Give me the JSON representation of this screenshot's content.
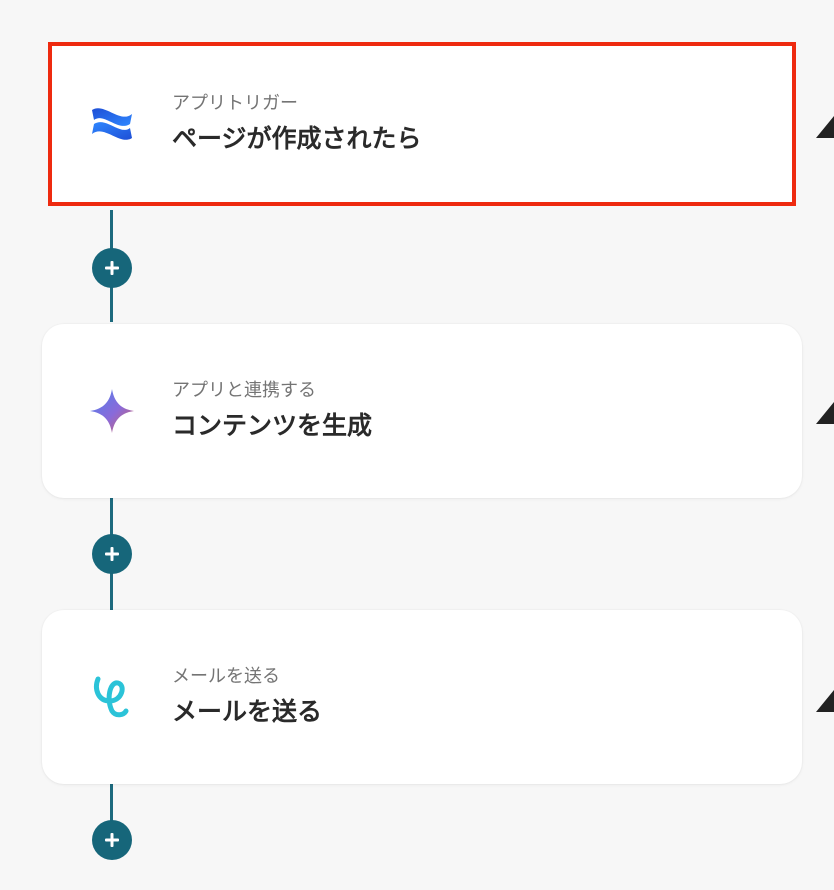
{
  "flow": {
    "steps": [
      {
        "subtitle": "アプリトリガー",
        "title": "ページが作成されたら",
        "icon": "confluence-icon"
      },
      {
        "subtitle": "アプリと連携する",
        "title": "コンテンツを生成",
        "icon": "gemini-sparkle-icon"
      },
      {
        "subtitle": "メールを送る",
        "title": "メールを送る",
        "icon": "mail-script-icon"
      }
    ],
    "add_button_icon": "plus-icon"
  },
  "colors": {
    "highlight_border": "#ee2a0f",
    "connector": "#1d6a7e",
    "add_button": "#16667a"
  }
}
